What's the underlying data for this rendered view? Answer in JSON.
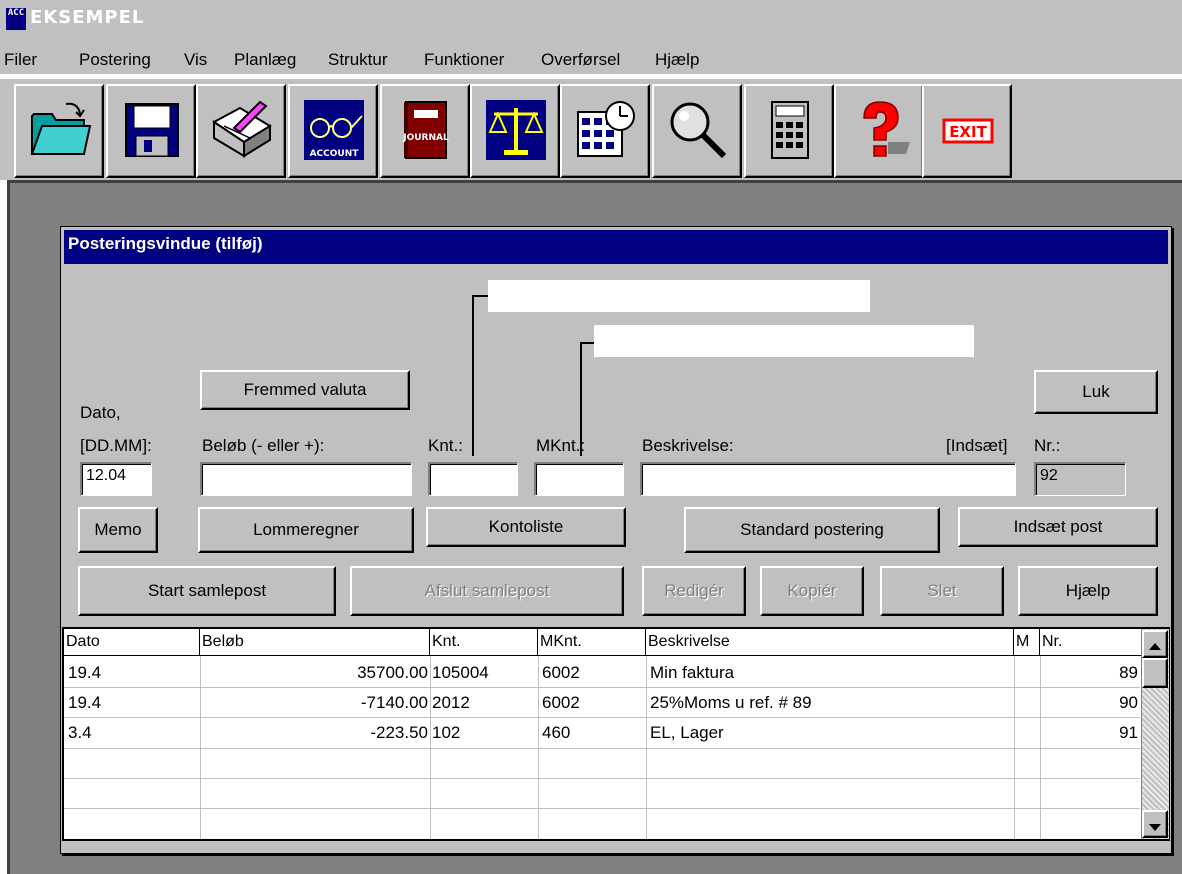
{
  "window": {
    "icon_text": "ACC",
    "title": "EKSEMPEL"
  },
  "menu": [
    "Filer",
    "Postering",
    "Vis",
    "Planlæg",
    "Struktur",
    "Funktioner",
    "Overførsel",
    "Hjælp"
  ],
  "toolbar": {
    "icons": [
      "open-folder-icon",
      "save-disk-icon",
      "edit-notepad-icon",
      "account-glasses-icon",
      "journal-book-icon",
      "balance-scale-icon",
      "calendar-clock-icon",
      "magnifier-icon",
      "calculator-icon",
      "help-question-icon",
      "exit-icon"
    ],
    "account_text": "ACCOUNT",
    "journal_text": "JOURNAL",
    "exit_text": "EXIT"
  },
  "dialog": {
    "title": "Posteringsvindue (tilføj)",
    "buttons": {
      "foreign_currency": "Fremmed valuta",
      "close": "Luk",
      "memo": "Memo",
      "calculator": "Lommeregner",
      "account_list": "Kontoliste",
      "standard_posting": "Standard postering",
      "insert_post": "Indsæt post",
      "start_batch": "Start samlepost",
      "end_batch": "Afslut samlepost",
      "edit": "Redigér",
      "copy": "Kopiér",
      "delete": "Slet",
      "help": "Hjælp"
    },
    "labels": {
      "date_line1": "Dato,",
      "date_line2": "[DD.MM]:",
      "amount": "Beløb (- eller +):",
      "account": "Knt.:",
      "counter_account": "MKnt.:",
      "description": "Beskrivelse:",
      "insert_hint": "[Indsæt]",
      "number": "Nr.:"
    },
    "fields": {
      "date": "12.04",
      "amount": "",
      "account": "",
      "counter_account": "",
      "description": "",
      "number": "92"
    }
  },
  "table": {
    "columns": [
      "Dato",
      "Beløb",
      "Knt.",
      "MKnt.",
      "Beskrivelse",
      "M",
      "Nr."
    ],
    "rows": [
      [
        "19.4",
        "35700.00",
        "105004",
        "6002",
        "Min faktura",
        "",
        "89"
      ],
      [
        "19.4",
        "-7140.00",
        "2012",
        "6002",
        "25%Moms u  ref. # 89",
        "",
        "90"
      ],
      [
        "3.4",
        "-223.50",
        "102",
        "460",
        "EL, Lager",
        "",
        "91"
      ]
    ]
  }
}
